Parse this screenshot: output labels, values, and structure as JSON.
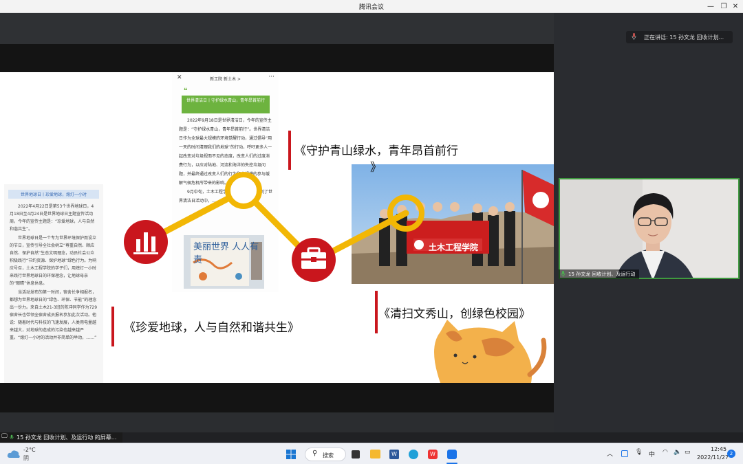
{
  "window": {
    "title": "腾讯会议",
    "controls": [
      "—",
      "❐",
      "✕"
    ]
  },
  "speaking": {
    "label": "正在讲话: 15 孙文龙 回收计划..."
  },
  "participant": {
    "name": "15 孙文龙 回收计划、及运行动"
  },
  "share_bar": {
    "label": "15 孙文龙 回收计划、及运行动 的屏幕..."
  },
  "slide": {
    "phone": {
      "account": "新工院 新土木 >",
      "banner": "世界清洁日丨守护绿水青山，青年昂首前行",
      "paragraphs": [
        "2022年9月18日是世界清洁日，今年的宣传主题是：“守护绿水青山，青年昂首前行”。世界清洁日作为全球最大规模的环境觉醒行动，通过倡导“用一天的时间清理我们的地球”的行动，呼吁更多人一起改变对垃圾视而不见的态度，改变人们的过度消费行为，以应对陆地、河流和海洋的失控垃圾问题，并最终通过改变人们的行为和大规模的参与缓解气候危机所带来的影响。",
        "9月中旬，土木工程学院分团委积极参与到了世界清洁日活动中，……"
      ],
      "poster_text": "美丽世界 人人有责"
    },
    "left_doc": {
      "header": "世界地球日丨珍爱地球，熄灯一小时",
      "paragraphs": [
        "2022年4月22日是第53个世界地球日，4月18日至4月24日是世界地球日主题宣传活动周，今年的宣传主题是：“珍爱地球，人与自然和谐共生”。",
        "世界地球日是一个专为世界环境保护而设立的节日，宣传引导全社会树立“尊重自然、顺应自然、保护自然”生态文明理念，动员社会公众积极践行“节约资源、保护地球”绿色行为。为响应号召，土木工程学院的学子们，用熄灯一小时来践行世界地球日的环保理念，让地球母亲的“眼睛”休息休息。",
        "当活动发布的第一时间，宿舍长争相报名，都想为世界地球日的“绿色、环保、节能”的理念出一份力。来自土木21-3班的陈冲同学作为729宿舍长也带领全宿舍成员报名参加此次活动。他说：随着时代与科技的飞速发展，人类用电量越来越大，对地球的造成的污染也越来越严重。“熄灯一小时的活动并非简单的举动，……”"
      ]
    },
    "captions": {
      "top": "《守护青山绿水，青年昂首前行",
      "top_tail": "》",
      "left": "《珍爱地球，人与自然和谐共生》",
      "right": "《清扫文秀山，创绿色校园》"
    },
    "photo": {
      "banner_text": "土木工程学院"
    },
    "colors": {
      "accent_red": "#c9161d",
      "path_yellow": "#f2b705",
      "cat_orange": "#f3b14b"
    }
  },
  "taskbar": {
    "weather_temp": "-2°C",
    "weather_desc": "阴",
    "search_label": "搜索",
    "ime": "中",
    "time": "12:45",
    "date": "2022/11/27",
    "notification_count": "2"
  }
}
